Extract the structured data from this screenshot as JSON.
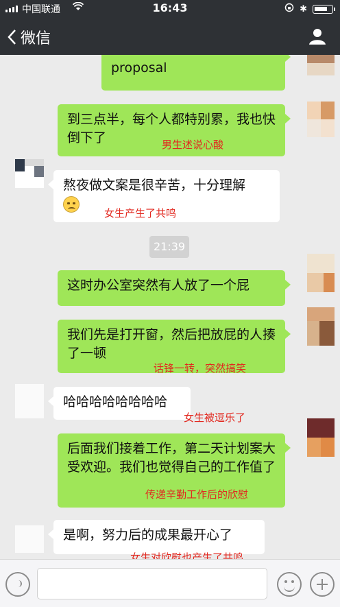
{
  "status_bar": {
    "carrier": "中国联通",
    "wifi_icon": "wifi-icon",
    "time": "16:43",
    "lock_icon": "orientation-lock-icon",
    "bluetooth_icon": "bluetooth-icon",
    "bluetooth_glyph": "✱"
  },
  "nav": {
    "back_label": "微信",
    "contact_icon": "person-icon"
  },
  "chat": {
    "timestamp": "21:39",
    "messages": [
      {
        "side": "me",
        "text": "有一次我们组熬夜做一个proposal",
        "visible_text": "proposal"
      },
      {
        "side": "me",
        "text": "到三点半，每个人都特别累，我也快倒下了",
        "note": "男生述说心酸"
      },
      {
        "side": "them",
        "text": "熬夜做文案是很辛苦，十分理解",
        "emoji": "tired-face-emoji",
        "note": "女生产生了共鸣"
      },
      {
        "side": "me",
        "text": "这时办公室突然有人放了一个屁"
      },
      {
        "side": "me",
        "text": "我们先是打开窗，然后把放屁的人揍了一顿",
        "note": "话锋一转，突然搞笑"
      },
      {
        "side": "them",
        "text": "哈哈哈哈哈哈哈哈",
        "note": "女生被逗乐了"
      },
      {
        "side": "me",
        "text": "后面我们接着工作，第二天计划案大受欢迎。我们也觉得自己的工作值了",
        "note": "传递辛勤工作后的欣慰"
      },
      {
        "side": "them",
        "text": "是啊，努力后的成果最开心了",
        "note": "女生对欣慰也产生了共鸣"
      }
    ]
  },
  "input_bar": {
    "voice_icon": "voice-icon",
    "emoji_icon": "emoji-icon",
    "plus_icon": "plus-icon"
  },
  "colors": {
    "nav_bg": "#2e3135",
    "chat_bg": "#ebebeb",
    "my_bubble": "#9fe658",
    "their_bubble": "#ffffff",
    "annotation": "#e2281f"
  }
}
